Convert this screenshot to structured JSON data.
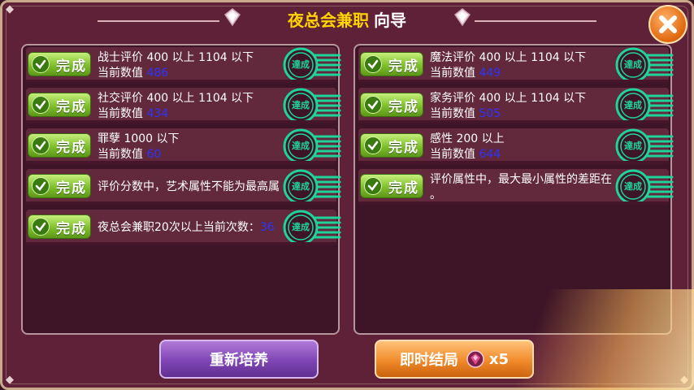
{
  "header": {
    "title_main": "夜总会兼职",
    "title_sub": "向导"
  },
  "status": {
    "done_label": "完成",
    "stamp_text": "達成"
  },
  "left_tasks": [
    {
      "prefix": "战士评价 400 以上 1104 以下",
      "current_label": "当前数值",
      "current_value": "486"
    },
    {
      "prefix": "社交评价 400 以上 1104 以下",
      "current_label": "当前数值",
      "current_value": "434"
    },
    {
      "prefix": "罪孽 1000 以下",
      "current_label": "当前数值",
      "current_value": "60"
    },
    {
      "prefix": "评价分数中，艺术属性不能为最高属",
      "current_label": "",
      "current_value": ""
    },
    {
      "prefix": "夜总会兼职20次以上当前次数：",
      "current_label": "",
      "current_value": "36"
    }
  ],
  "right_tasks": [
    {
      "prefix": "魔法评价 400 以上 1104 以下",
      "current_label": "当前数值",
      "current_value": "449"
    },
    {
      "prefix": "家务评价 400 以上 1104 以下",
      "current_label": "当前数值",
      "current_value": "505"
    },
    {
      "prefix": "感性 200 以上",
      "current_label": "当前数值",
      "current_value": "644"
    },
    {
      "prefix": "评价属性中，最大最小属性的差距在",
      "current_label": "。",
      "current_value": ""
    }
  ],
  "buttons": {
    "retrain": "重新培养",
    "instant": "即时结局",
    "cost": "x5"
  },
  "colors": {
    "title": "#ffd400",
    "value": "#2b35ff",
    "done": "#7fbf2c",
    "stamp": "#1fd49a"
  }
}
